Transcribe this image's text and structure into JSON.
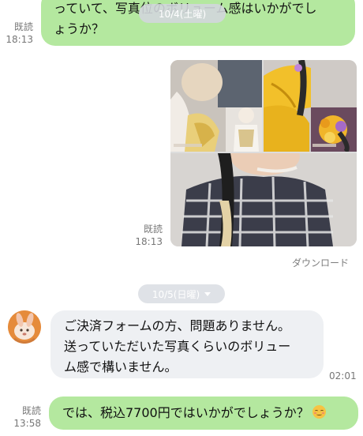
{
  "messages": [
    {
      "sender": "me",
      "lines": [
        "っていて、写真位のボリューム感はいかがでし",
        "ょうか？"
      ],
      "read": "既読",
      "time": "18:13"
    },
    {
      "sender": "me",
      "type": "photo-collage",
      "read": "既読",
      "time": "18:13",
      "download_label": "ダウンロード"
    },
    {
      "sender": "them",
      "lines": [
        "ご決済フォームの方、問題ありません。",
        "送っていただいた写真くらいのボリュー",
        "ム感で構いません。"
      ],
      "time": "02:01"
    },
    {
      "sender": "me",
      "text": "では、税込7700円ではいかがでしょうか？",
      "emoji": "relieved-face",
      "read": "既読",
      "time": "13:58"
    }
  ],
  "date_dividers": [
    {
      "label": "10/4(土曜)"
    },
    {
      "label": "10/5(日曜)"
    }
  ],
  "colors": {
    "my_bubble": "#b4e89f",
    "their_bubble": "#eef0f3",
    "date_pill": "#dfe2e7",
    "meta_text": "#777777"
  }
}
